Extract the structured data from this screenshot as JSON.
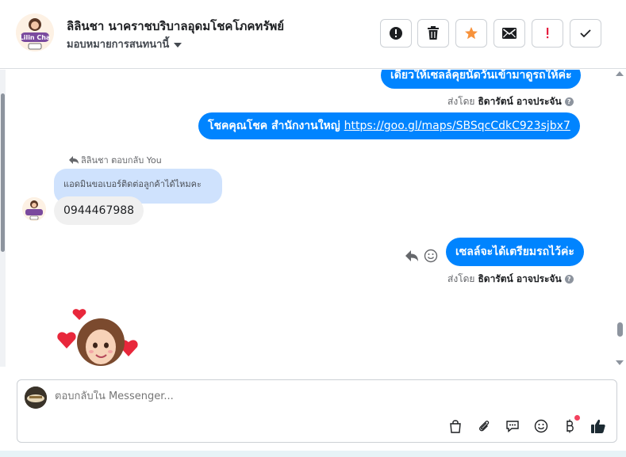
{
  "header": {
    "title": "ลิลินชา นาคราชบริบาลอุดมโชคโภคทรัพย์",
    "assign_label": "มอบหมายการสนทนานี้",
    "avatar_logo_text": "Lilin Cha"
  },
  "toolbar": {
    "buttons": [
      {
        "name": "alert-circle",
        "label": "!"
      },
      {
        "name": "trash",
        "label": ""
      },
      {
        "name": "star",
        "label": ""
      },
      {
        "name": "mail",
        "label": ""
      },
      {
        "name": "spam",
        "label": "!"
      },
      {
        "name": "done",
        "label": ""
      }
    ],
    "star_color": "#f7923b",
    "spam_color": "#e41e3f"
  },
  "messages": {
    "msg1_text": "เดี๋ยวให้เซลล์คุยนัดวันเข้ามาดูรถให้ค่ะ",
    "msg1_sent_prefix": "ส่งโดย",
    "msg1_sender": "ธิดารัตน์ อาจประจัน",
    "msg2_prefix": "โชคคุณโชค สำนักงานใหญ่",
    "msg2_link": "https://goo.gl/maps/SBSqcCdkC923sjbx7",
    "reply_header": "ลิลินชา ตอบกลับ You",
    "quoted_text": "แอดมินขอเบอร์ติดต่อลูกค้าได้ไหมคะ",
    "incoming_text": "0944467988",
    "msg3_text": "เซลล์จะได้เตรียมรถไว้ค่ะ",
    "msg3_sent_prefix": "ส่งโดย",
    "msg3_sender": "ธิดารัตน์ อาจประจัน",
    "help_glyph": "?"
  },
  "composer": {
    "placeholder": "ตอบกลับใน Messenger..."
  },
  "colors": {
    "accent": "#0084ff",
    "quoted_bg": "#cfe2fd",
    "incoming_bg": "#f0f0f0",
    "like": "#1c2b33"
  }
}
